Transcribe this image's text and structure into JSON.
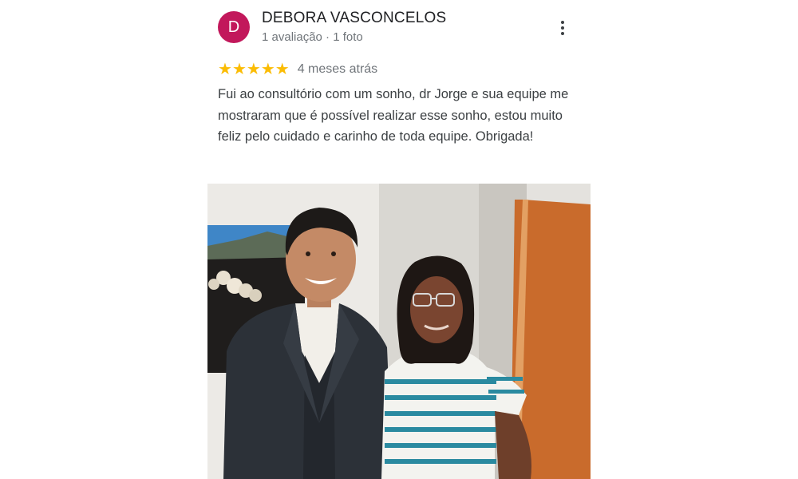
{
  "review": {
    "author": {
      "name": "DEBORA VASCONCELOS",
      "initial": "D",
      "avatar_color": "#c2185b",
      "stats": "1 avaliação · 1 foto"
    },
    "rating": 5,
    "star_color": "#fbbc04",
    "time_ago": "4 meses atrás",
    "text": "Fui ao consultório com um sonho, dr Jorge e sua equipe me mostraram que é possível realizar esse sonho, estou muito feliz pelo cuidado e carinho de toda equipe. Obrigada!",
    "photo": {
      "subject": "two people posing in a dental office"
    },
    "menu_icon": "more-vert-icon"
  }
}
